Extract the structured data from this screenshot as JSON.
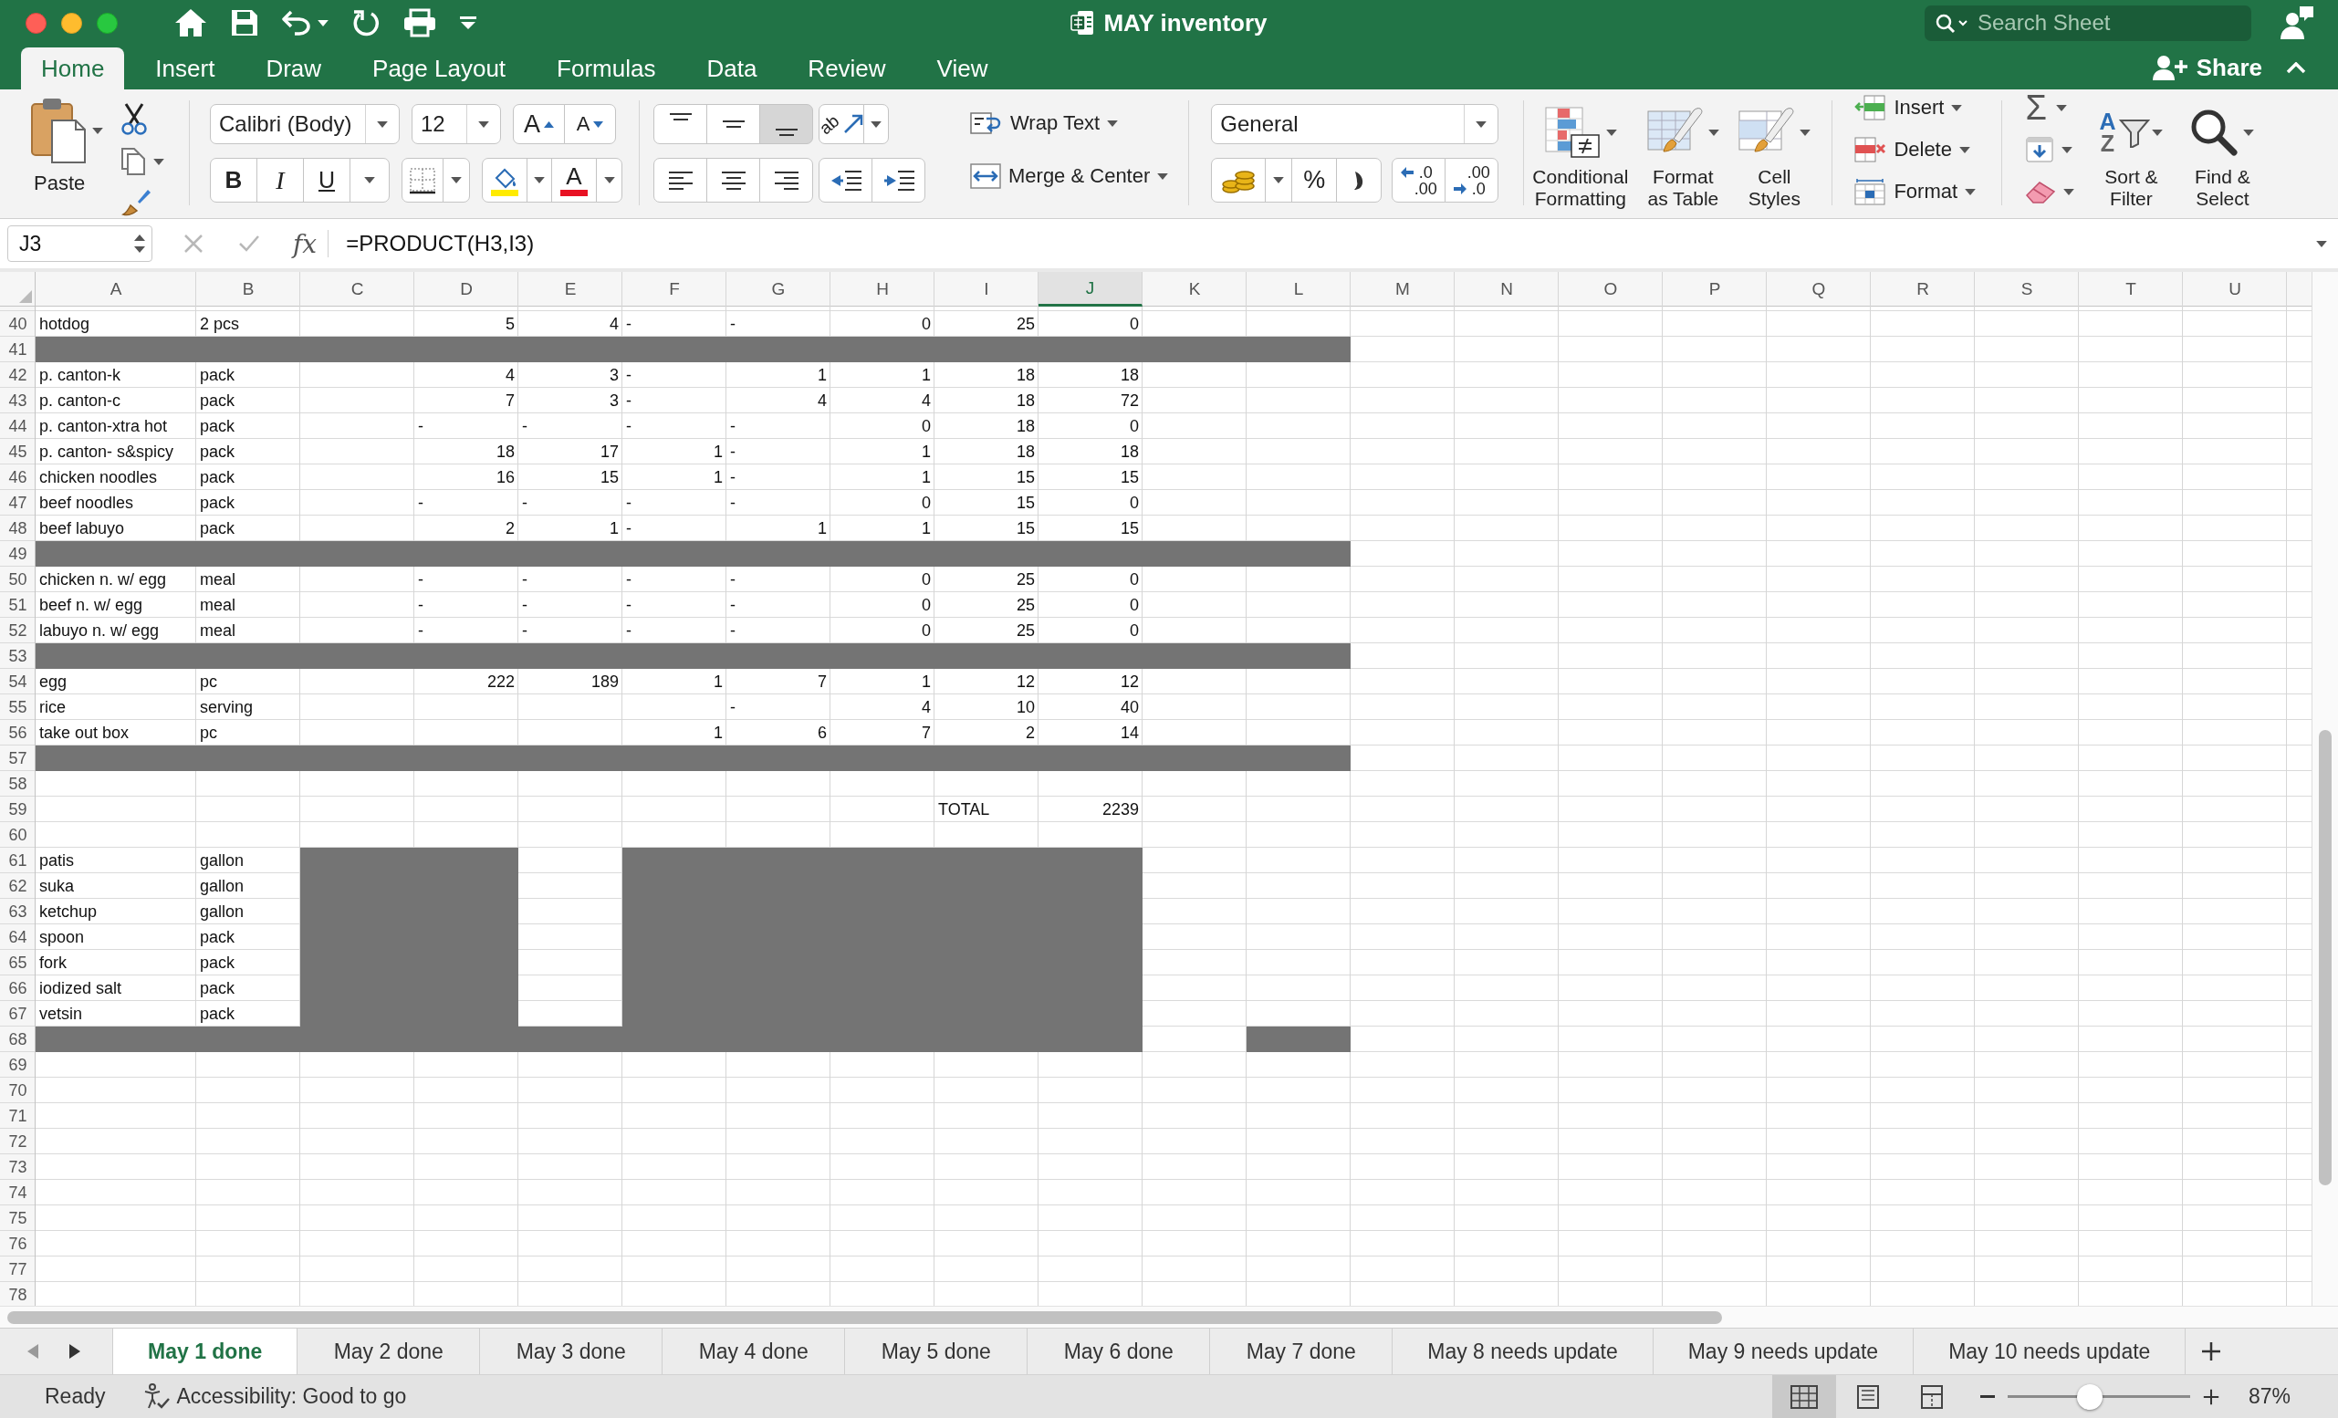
{
  "window": {
    "title": "MAY inventory"
  },
  "search": {
    "placeholder": "Search Sheet"
  },
  "share": {
    "label": "Share"
  },
  "ribbon_tabs": [
    {
      "label": "Home",
      "selected": true
    },
    {
      "label": "Insert",
      "selected": false
    },
    {
      "label": "Draw",
      "selected": false
    },
    {
      "label": "Page Layout",
      "selected": false
    },
    {
      "label": "Formulas",
      "selected": false
    },
    {
      "label": "Data",
      "selected": false
    },
    {
      "label": "Review",
      "selected": false
    },
    {
      "label": "View",
      "selected": false
    }
  ],
  "ribbon": {
    "clipboard": {
      "paste": "Paste"
    },
    "font": {
      "name": "Calibri (Body)",
      "size": "12",
      "size_buttons": [
        {
          "kind": "grow",
          "label": "A"
        },
        {
          "kind": "shrink",
          "label": "A"
        }
      ],
      "style_buttons": [
        {
          "kind": "bold",
          "label": "B"
        },
        {
          "kind": "italic",
          "label": "I"
        },
        {
          "kind": "underline",
          "label": "U"
        }
      ],
      "font_color": {
        "label": "A"
      }
    },
    "alignment": {
      "vertical": [
        {
          "kind": "top",
          "selected": false
        },
        {
          "kind": "middle",
          "selected": false
        },
        {
          "kind": "bottom",
          "selected": true
        }
      ],
      "orientation": "ab",
      "horizontal": [
        {
          "kind": "left",
          "selected": false
        },
        {
          "kind": "center",
          "selected": false
        },
        {
          "kind": "right",
          "selected": false
        }
      ],
      "wrap_text": "Wrap Text",
      "merge": "Merge & Center"
    },
    "number": {
      "format": "General",
      "percent": "%",
      "decimals": [
        {
          "kind": "increase",
          "top": ".0",
          "bottom": ".00"
        },
        {
          "kind": "decrease",
          "top": ".00",
          "bottom": ".0"
        }
      ]
    },
    "styles": [
      {
        "kind": "conditional",
        "label": "Conditional\nFormatting"
      },
      {
        "kind": "table",
        "label": "Format\nas Table"
      },
      {
        "kind": "cell",
        "label": "Cell\nStyles"
      }
    ],
    "cells": [
      {
        "kind": "insert",
        "label": "Insert"
      },
      {
        "kind": "delete",
        "label": "Delete"
      },
      {
        "kind": "format",
        "label": "Format"
      }
    ],
    "editing": {
      "sum": "Σ",
      "buttons": [
        {
          "kind": "sort",
          "label": "Sort &\nFilter",
          "letters": [
            "A",
            "Z"
          ]
        },
        {
          "kind": "find",
          "label": "Find &\nSelect"
        }
      ]
    }
  },
  "formula_bar": {
    "name_box": "J3",
    "function_label": "fx",
    "formula": "=PRODUCT(H3,I3)"
  },
  "sheet": {
    "columns": [
      {
        "label": "A",
        "selected": false
      },
      {
        "label": "B",
        "selected": false
      },
      {
        "label": "C",
        "selected": false
      },
      {
        "label": "D",
        "selected": false
      },
      {
        "label": "E",
        "selected": false
      },
      {
        "label": "F",
        "selected": false
      },
      {
        "label": "G",
        "selected": false
      },
      {
        "label": "H",
        "selected": false
      },
      {
        "label": "I",
        "selected": false
      },
      {
        "label": "J",
        "selected": true
      },
      {
        "label": "K",
        "selected": false
      },
      {
        "label": "L",
        "selected": false
      },
      {
        "label": "M",
        "selected": false
      },
      {
        "label": "N",
        "selected": false
      },
      {
        "label": "O",
        "selected": false
      },
      {
        "label": "P",
        "selected": false
      },
      {
        "label": "Q",
        "selected": false
      },
      {
        "label": "R",
        "selected": false
      },
      {
        "label": "S",
        "selected": false
      },
      {
        "label": "T",
        "selected": false
      },
      {
        "label": "U",
        "selected": false
      }
    ],
    "rows": [
      {
        "number": "40",
        "cells": {
          "A": {
            "text": "hotdog",
            "kind": "text"
          },
          "B": {
            "text": "2 pcs",
            "kind": "text"
          },
          "D": {
            "text": "5",
            "kind": "number"
          },
          "E": {
            "text": "4",
            "kind": "number"
          },
          "F": {
            "text": "-",
            "kind": "text"
          },
          "G": {
            "text": "-",
            "kind": "text"
          },
          "H": {
            "text": "0",
            "kind": "number"
          },
          "I": {
            "text": "25",
            "kind": "number"
          },
          "J": {
            "text": "0",
            "kind": "number"
          }
        }
      },
      {
        "number": "41",
        "cells": {
          "A": {
            "kind": "fill"
          },
          "B": {
            "kind": "fill"
          },
          "C": {
            "kind": "fill"
          },
          "D": {
            "kind": "fill"
          },
          "E": {
            "kind": "fill"
          },
          "F": {
            "kind": "fill"
          },
          "G": {
            "kind": "fill"
          },
          "H": {
            "kind": "fill"
          },
          "I": {
            "kind": "fill"
          },
          "J": {
            "kind": "fill"
          },
          "K": {
            "kind": "fill"
          },
          "L": {
            "kind": "fill"
          }
        }
      },
      {
        "number": "42",
        "cells": {
          "A": {
            "text": "p. canton-k",
            "kind": "text"
          },
          "B": {
            "text": "pack",
            "kind": "text"
          },
          "D": {
            "text": "4",
            "kind": "number"
          },
          "E": {
            "text": "3",
            "kind": "number"
          },
          "F": {
            "text": "-",
            "kind": "text"
          },
          "G": {
            "text": "1",
            "kind": "number"
          },
          "H": {
            "text": "1",
            "kind": "number"
          },
          "I": {
            "text": "18",
            "kind": "number"
          },
          "J": {
            "text": "18",
            "kind": "number"
          }
        }
      },
      {
        "number": "43",
        "cells": {
          "A": {
            "text": "p. canton-c",
            "kind": "text"
          },
          "B": {
            "text": "pack",
            "kind": "text"
          },
          "D": {
            "text": "7",
            "kind": "number"
          },
          "E": {
            "text": "3",
            "kind": "number"
          },
          "F": {
            "text": "-",
            "kind": "text"
          },
          "G": {
            "text": "4",
            "kind": "number"
          },
          "H": {
            "text": "4",
            "kind": "number"
          },
          "I": {
            "text": "18",
            "kind": "number"
          },
          "J": {
            "text": "72",
            "kind": "number"
          }
        }
      },
      {
        "number": "44",
        "cells": {
          "A": {
            "text": "p. canton-xtra hot",
            "kind": "text"
          },
          "B": {
            "text": "pack",
            "kind": "text"
          },
          "D": {
            "text": "-",
            "kind": "text"
          },
          "E": {
            "text": "-",
            "kind": "text"
          },
          "F": {
            "text": "-",
            "kind": "text"
          },
          "G": {
            "text": "-",
            "kind": "text"
          },
          "H": {
            "text": "0",
            "kind": "number"
          },
          "I": {
            "text": "18",
            "kind": "number"
          },
          "J": {
            "text": "0",
            "kind": "number"
          }
        }
      },
      {
        "number": "45",
        "cells": {
          "A": {
            "text": "p. canton- s&spicy",
            "kind": "text"
          },
          "B": {
            "text": "pack",
            "kind": "text"
          },
          "D": {
            "text": "18",
            "kind": "number"
          },
          "E": {
            "text": "17",
            "kind": "number"
          },
          "F": {
            "text": "1",
            "kind": "number"
          },
          "G": {
            "text": "-",
            "kind": "text"
          },
          "H": {
            "text": "1",
            "kind": "number"
          },
          "I": {
            "text": "18",
            "kind": "number"
          },
          "J": {
            "text": "18",
            "kind": "number"
          }
        }
      },
      {
        "number": "46",
        "cells": {
          "A": {
            "text": "chicken noodles",
            "kind": "text"
          },
          "B": {
            "text": "pack",
            "kind": "text"
          },
          "D": {
            "text": "16",
            "kind": "number"
          },
          "E": {
            "text": "15",
            "kind": "number"
          },
          "F": {
            "text": "1",
            "kind": "number"
          },
          "G": {
            "text": "-",
            "kind": "text"
          },
          "H": {
            "text": "1",
            "kind": "number"
          },
          "I": {
            "text": "15",
            "kind": "number"
          },
          "J": {
            "text": "15",
            "kind": "number"
          }
        }
      },
      {
        "number": "47",
        "cells": {
          "A": {
            "text": "beef noodles",
            "kind": "text"
          },
          "B": {
            "text": "pack",
            "kind": "text"
          },
          "D": {
            "text": "-",
            "kind": "text"
          },
          "E": {
            "text": "-",
            "kind": "text"
          },
          "F": {
            "text": "-",
            "kind": "text"
          },
          "G": {
            "text": "-",
            "kind": "text"
          },
          "H": {
            "text": "0",
            "kind": "number"
          },
          "I": {
            "text": "15",
            "kind": "number"
          },
          "J": {
            "text": "0",
            "kind": "number"
          }
        }
      },
      {
        "number": "48",
        "cells": {
          "A": {
            "text": "beef labuyo",
            "kind": "text"
          },
          "B": {
            "text": "pack",
            "kind": "text"
          },
          "D": {
            "text": "2",
            "kind": "number"
          },
          "E": {
            "text": "1",
            "kind": "number"
          },
          "F": {
            "text": "-",
            "kind": "text"
          },
          "G": {
            "text": "1",
            "kind": "number"
          },
          "H": {
            "text": "1",
            "kind": "number"
          },
          "I": {
            "text": "15",
            "kind": "number"
          },
          "J": {
            "text": "15",
            "kind": "number"
          }
        }
      },
      {
        "number": "49",
        "cells": {
          "A": {
            "kind": "fill"
          },
          "B": {
            "kind": "fill"
          },
          "C": {
            "kind": "fill"
          },
          "D": {
            "kind": "fill"
          },
          "E": {
            "kind": "fill"
          },
          "F": {
            "kind": "fill"
          },
          "G": {
            "kind": "fill"
          },
          "H": {
            "kind": "fill"
          },
          "I": {
            "kind": "fill"
          },
          "J": {
            "kind": "fill"
          },
          "K": {
            "kind": "fill"
          },
          "L": {
            "kind": "fill"
          }
        }
      },
      {
        "number": "50",
        "cells": {
          "A": {
            "text": "chicken n. w/ egg",
            "kind": "text"
          },
          "B": {
            "text": "meal",
            "kind": "text"
          },
          "D": {
            "text": "-",
            "kind": "text"
          },
          "E": {
            "text": "-",
            "kind": "text"
          },
          "F": {
            "text": "-",
            "kind": "text"
          },
          "G": {
            "text": "-",
            "kind": "text"
          },
          "H": {
            "text": "0",
            "kind": "number"
          },
          "I": {
            "text": "25",
            "kind": "number"
          },
          "J": {
            "text": "0",
            "kind": "number"
          }
        }
      },
      {
        "number": "51",
        "cells": {
          "A": {
            "text": "beef n. w/ egg",
            "kind": "text"
          },
          "B": {
            "text": "meal",
            "kind": "text"
          },
          "D": {
            "text": "-",
            "kind": "text"
          },
          "E": {
            "text": "-",
            "kind": "text"
          },
          "F": {
            "text": "-",
            "kind": "text"
          },
          "G": {
            "text": "-",
            "kind": "text"
          },
          "H": {
            "text": "0",
            "kind": "number"
          },
          "I": {
            "text": "25",
            "kind": "number"
          },
          "J": {
            "text": "0",
            "kind": "number"
          }
        }
      },
      {
        "number": "52",
        "cells": {
          "A": {
            "text": "labuyo n. w/ egg",
            "kind": "text"
          },
          "B": {
            "text": "meal",
            "kind": "text"
          },
          "D": {
            "text": "-",
            "kind": "text"
          },
          "E": {
            "text": "-",
            "kind": "text"
          },
          "F": {
            "text": "-",
            "kind": "text"
          },
          "G": {
            "text": "-",
            "kind": "text"
          },
          "H": {
            "text": "0",
            "kind": "number"
          },
          "I": {
            "text": "25",
            "kind": "number"
          },
          "J": {
            "text": "0",
            "kind": "number"
          }
        }
      },
      {
        "number": "53",
        "cells": {
          "A": {
            "kind": "fill"
          },
          "B": {
            "kind": "fill"
          },
          "C": {
            "kind": "fill"
          },
          "D": {
            "kind": "fill"
          },
          "E": {
            "kind": "fill"
          },
          "F": {
            "kind": "fill"
          },
          "G": {
            "kind": "fill"
          },
          "H": {
            "kind": "fill"
          },
          "I": {
            "kind": "fill"
          },
          "J": {
            "kind": "fill"
          },
          "K": {
            "kind": "fill"
          },
          "L": {
            "kind": "fill"
          }
        }
      },
      {
        "number": "54",
        "cells": {
          "A": {
            "text": "egg",
            "kind": "text"
          },
          "B": {
            "text": "pc",
            "kind": "text"
          },
          "D": {
            "text": "222",
            "kind": "number"
          },
          "E": {
            "text": "189",
            "kind": "number"
          },
          "F": {
            "text": "1",
            "kind": "number"
          },
          "G": {
            "text": "7",
            "kind": "number"
          },
          "H": {
            "text": "1",
            "kind": "number"
          },
          "I": {
            "text": "12",
            "kind": "number"
          },
          "J": {
            "text": "12",
            "kind": "number"
          }
        }
      },
      {
        "number": "55",
        "cells": {
          "A": {
            "text": "rice",
            "kind": "text"
          },
          "B": {
            "text": "serving",
            "kind": "text"
          },
          "G": {
            "text": "-",
            "kind": "text"
          },
          "H": {
            "text": "4",
            "kind": "number"
          },
          "I": {
            "text": "10",
            "kind": "number"
          },
          "J": {
            "text": "40",
            "kind": "number"
          }
        }
      },
      {
        "number": "56",
        "cells": {
          "A": {
            "text": "take out box",
            "kind": "text"
          },
          "B": {
            "text": "pc",
            "kind": "text"
          },
          "F": {
            "text": "1",
            "kind": "number"
          },
          "G": {
            "text": "6",
            "kind": "number"
          },
          "H": {
            "text": "7",
            "kind": "number"
          },
          "I": {
            "text": "2",
            "kind": "number"
          },
          "J": {
            "text": "14",
            "kind": "number"
          }
        }
      },
      {
        "number": "57",
        "cells": {
          "A": {
            "kind": "fill"
          },
          "B": {
            "kind": "fill"
          },
          "C": {
            "kind": "fill"
          },
          "D": {
            "kind": "fill"
          },
          "E": {
            "kind": "fill"
          },
          "F": {
            "kind": "fill"
          },
          "G": {
            "kind": "fill"
          },
          "H": {
            "kind": "fill"
          },
          "I": {
            "kind": "fill"
          },
          "J": {
            "kind": "fill"
          },
          "K": {
            "kind": "fill"
          },
          "L": {
            "kind": "fill"
          }
        }
      },
      {
        "number": "58"
      },
      {
        "number": "59",
        "cells": {
          "I": {
            "text": "TOTAL",
            "kind": "text"
          },
          "J": {
            "text": "2239",
            "kind": "number"
          }
        }
      },
      {
        "number": "60"
      },
      {
        "number": "61",
        "cells": {
          "A": {
            "text": "patis",
            "kind": "text"
          },
          "B": {
            "text": "gallon",
            "kind": "text"
          },
          "C": {
            "kind": "fill"
          },
          "D": {
            "kind": "fill"
          },
          "F": {
            "kind": "fill"
          },
          "G": {
            "kind": "fill"
          },
          "H": {
            "kind": "fill"
          },
          "I": {
            "kind": "fill"
          },
          "J": {
            "kind": "fill"
          }
        }
      },
      {
        "number": "62",
        "cells": {
          "A": {
            "text": "suka",
            "kind": "text"
          },
          "B": {
            "text": "gallon",
            "kind": "text"
          },
          "C": {
            "kind": "fill"
          },
          "D": {
            "kind": "fill"
          },
          "F": {
            "kind": "fill"
          },
          "G": {
            "kind": "fill"
          },
          "H": {
            "kind": "fill"
          },
          "I": {
            "kind": "fill"
          },
          "J": {
            "kind": "fill"
          }
        }
      },
      {
        "number": "63",
        "cells": {
          "A": {
            "text": "ketchup",
            "kind": "text"
          },
          "B": {
            "text": "gallon",
            "kind": "text"
          },
          "C": {
            "kind": "fill"
          },
          "D": {
            "kind": "fill"
          },
          "F": {
            "kind": "fill"
          },
          "G": {
            "kind": "fill"
          },
          "H": {
            "kind": "fill"
          },
          "I": {
            "kind": "fill"
          },
          "J": {
            "kind": "fill"
          }
        }
      },
      {
        "number": "64",
        "cells": {
          "A": {
            "text": "spoon",
            "kind": "text"
          },
          "B": {
            "text": "pack",
            "kind": "text"
          },
          "C": {
            "kind": "fill"
          },
          "D": {
            "kind": "fill"
          },
          "F": {
            "kind": "fill"
          },
          "G": {
            "kind": "fill"
          },
          "H": {
            "kind": "fill"
          },
          "I": {
            "kind": "fill"
          },
          "J": {
            "kind": "fill"
          }
        }
      },
      {
        "number": "65",
        "cells": {
          "A": {
            "text": "fork",
            "kind": "text"
          },
          "B": {
            "text": "pack",
            "kind": "text"
          },
          "C": {
            "kind": "fill"
          },
          "D": {
            "kind": "fill"
          },
          "F": {
            "kind": "fill"
          },
          "G": {
            "kind": "fill"
          },
          "H": {
            "kind": "fill"
          },
          "I": {
            "kind": "fill"
          },
          "J": {
            "kind": "fill"
          }
        }
      },
      {
        "number": "66",
        "cells": {
          "A": {
            "text": "iodized salt",
            "kind": "text"
          },
          "B": {
            "text": "pack",
            "kind": "text"
          },
          "C": {
            "kind": "fill"
          },
          "D": {
            "kind": "fill"
          },
          "F": {
            "kind": "fill"
          },
          "G": {
            "kind": "fill"
          },
          "H": {
            "kind": "fill"
          },
          "I": {
            "kind": "fill"
          },
          "J": {
            "kind": "fill"
          }
        }
      },
      {
        "number": "67",
        "cells": {
          "A": {
            "text": "vetsin",
            "kind": "text"
          },
          "B": {
            "text": "pack",
            "kind": "text"
          },
          "C": {
            "kind": "fill"
          },
          "D": {
            "kind": "fill"
          },
          "F": {
            "kind": "fill"
          },
          "G": {
            "kind": "fill"
          },
          "H": {
            "kind": "fill"
          },
          "I": {
            "kind": "fill"
          },
          "J": {
            "kind": "fill"
          }
        }
      },
      {
        "number": "68",
        "cells": {
          "A": {
            "kind": "fill"
          },
          "B": {
            "kind": "fill"
          },
          "C": {
            "kind": "fill"
          },
          "D": {
            "kind": "fill"
          },
          "E": {
            "kind": "fill"
          },
          "F": {
            "kind": "fill"
          },
          "G": {
            "kind": "fill"
          },
          "H": {
            "kind": "fill"
          },
          "I": {
            "kind": "fill"
          },
          "J": {
            "kind": "fill"
          },
          "L": {
            "kind": "fill"
          }
        }
      },
      {
        "number": "69"
      },
      {
        "number": "70"
      },
      {
        "number": "71"
      },
      {
        "number": "72"
      },
      {
        "number": "73"
      },
      {
        "number": "74"
      },
      {
        "number": "75"
      },
      {
        "number": "76"
      },
      {
        "number": "77"
      },
      {
        "number": "78"
      }
    ]
  },
  "sheet_tabs": [
    {
      "label": "May 1 done",
      "selected": true
    },
    {
      "label": "May 2 done",
      "selected": false
    },
    {
      "label": "May 3 done",
      "selected": false
    },
    {
      "label": "May 4 done",
      "selected": false
    },
    {
      "label": "May 5 done",
      "selected": false
    },
    {
      "label": "May 6 done",
      "selected": false
    },
    {
      "label": "May 7 done",
      "selected": false
    },
    {
      "label": "May 8 needs update",
      "selected": false
    },
    {
      "label": "May 9 needs update",
      "selected": false
    },
    {
      "label": "May 10 needs update",
      "selected": false
    }
  ],
  "status_bar": {
    "mode": "Ready",
    "accessibility": "Accessibility: Good to go",
    "views": [
      {
        "kind": "normal",
        "selected": true
      },
      {
        "kind": "page_layout",
        "selected": false
      },
      {
        "kind": "page_break",
        "selected": false
      }
    ],
    "zoom": {
      "level": 0.44,
      "reading": "87%"
    }
  }
}
